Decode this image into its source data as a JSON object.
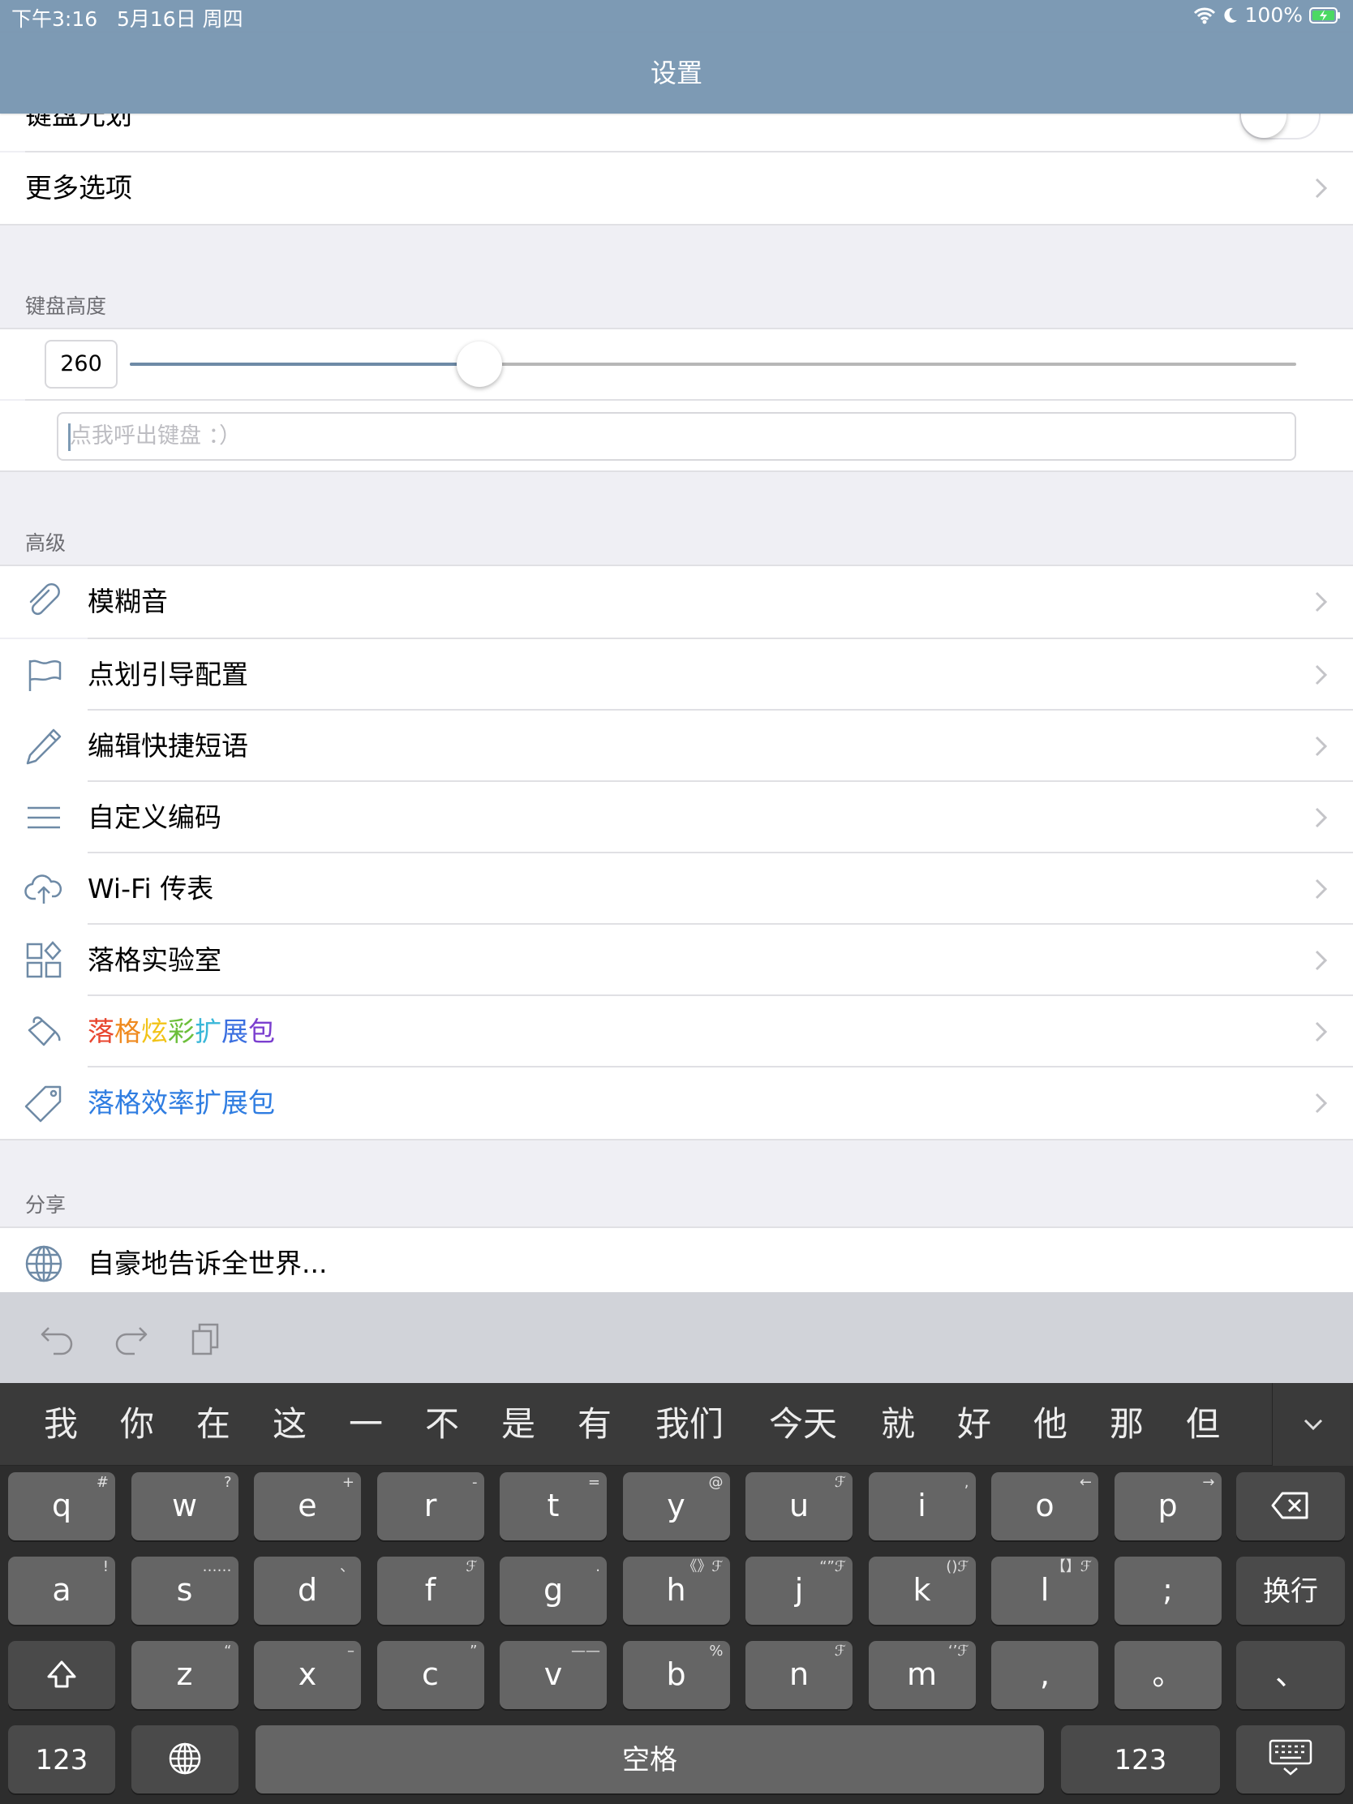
{
  "status": {
    "time": "下午3:16",
    "date": "5月16日 周四",
    "battery": "100%"
  },
  "nav": {
    "title": "设置"
  },
  "top_rows": [
    {
      "label": "键盘光划"
    },
    {
      "label": "更多选项"
    }
  ],
  "keyboard_height": {
    "header": "键盘高度",
    "value": "260",
    "slider_fraction": 0.3,
    "input_placeholder": "点我呼出键盘 ：）"
  },
  "advanced": {
    "header": "高级",
    "items": [
      {
        "label": "模糊音",
        "icon": "paperclip-icon"
      },
      {
        "label": "点划引导配置",
        "icon": "flag-icon"
      },
      {
        "label": "编辑快捷短语",
        "icon": "pencil-icon"
      },
      {
        "label": "自定义编码",
        "icon": "lines-icon"
      },
      {
        "label": "Wi-Fi 传表",
        "icon": "cloud-upload-icon"
      },
      {
        "label": "落格实验室",
        "icon": "grid-icon"
      },
      {
        "label": "落格炫彩扩展包",
        "icon": "paint-bucket-icon"
      },
      {
        "label": "落格效率扩展包",
        "icon": "tag-icon",
        "color": "#2f7de1"
      }
    ],
    "rainbow_colors": [
      "#e8462f",
      "#ef8a1f",
      "#f2c318",
      "#6cbf3a",
      "#39b7d8",
      "#3b6fe0",
      "#7b3fcf"
    ]
  },
  "share": {
    "header": "分享",
    "items": [
      {
        "label": "自豪地告诉全世界...",
        "icon": "globe-icon"
      }
    ]
  },
  "keyboard": {
    "toolbar": [
      "undo-icon",
      "redo-icon",
      "copy-icon"
    ],
    "candidates": [
      "我",
      "你",
      "在",
      "这",
      "一",
      "不",
      "是",
      "有",
      "我们",
      "今天",
      "就",
      "好",
      "他",
      "那",
      "但"
    ],
    "row1": [
      {
        "k": "q",
        "s": "#"
      },
      {
        "k": "w",
        "s": "?"
      },
      {
        "k": "e",
        "s": "+"
      },
      {
        "k": "r",
        "s": "-"
      },
      {
        "k": "t",
        "s": "="
      },
      {
        "k": "y",
        "s": "@"
      },
      {
        "k": "u",
        "s": "ℱ"
      },
      {
        "k": "i",
        "s": ","
      },
      {
        "k": "o",
        "s": "←"
      },
      {
        "k": "p",
        "s": "→"
      }
    ],
    "row2": [
      {
        "k": "a",
        "s": "!"
      },
      {
        "k": "s",
        "s": "……"
      },
      {
        "k": "d",
        "s": "、"
      },
      {
        "k": "f",
        "s": "ℱ"
      },
      {
        "k": "g",
        "s": "."
      },
      {
        "k": "h",
        "s": "《》ℱ"
      },
      {
        "k": "j",
        "s": "“”ℱ"
      },
      {
        "k": "k",
        "s": "()ℱ"
      },
      {
        "k": "l",
        "s": "【】ℱ"
      },
      {
        "k": ";",
        "s": ""
      }
    ],
    "row3": [
      {
        "k": "z",
        "s": "“"
      },
      {
        "k": "x",
        "s": "–"
      },
      {
        "k": "c",
        "s": "”"
      },
      {
        "k": "v",
        "s": "——"
      },
      {
        "k": "b",
        "s": "%"
      },
      {
        "k": "n",
        "s": "ℱ"
      },
      {
        "k": "m",
        "s": "‘’ℱ"
      },
      {
        "k": ",",
        "s": ""
      },
      {
        "k": "。",
        "s": ""
      },
      {
        "k": "、",
        "s": ""
      }
    ],
    "return_label": "换行",
    "num_label": "123",
    "space_label": "空格"
  }
}
